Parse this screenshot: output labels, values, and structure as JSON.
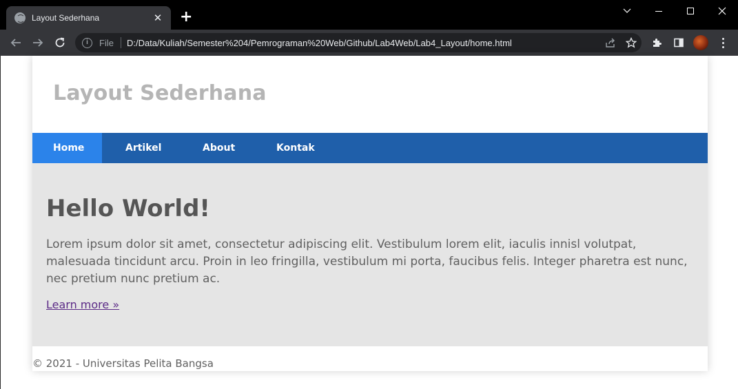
{
  "browser": {
    "tab_title": "Layout Sederhana",
    "new_tab_symbol": "+",
    "close_symbol": "✕",
    "address": {
      "scheme_label": "File",
      "url": "D:/Data/Kuliah/Semester%204/Pemrograman%20Web/Github/Lab4Web/Lab4_Layout/home.html"
    }
  },
  "site": {
    "title": "Layout Sederhana",
    "nav": [
      {
        "label": "Home",
        "active": true
      },
      {
        "label": "Artikel",
        "active": false
      },
      {
        "label": "About",
        "active": false
      },
      {
        "label": "Kontak",
        "active": false
      }
    ],
    "hero": {
      "heading": "Hello World!",
      "text": "Lorem ipsum dolor sit amet, consectetur adipiscing elit. Vestibulum lorem elit, iaculis innisl volutpat, malesuada tincidunt arcu. Proin in leo fringilla, vestibulum mi porta, faucibus felis. Integer pharetra est nunc, nec pretium nunc pretium ac.",
      "link_label": "Learn more »"
    },
    "footer": "© 2021 - Universitas Pelita Bangsa"
  },
  "colors": {
    "nav_bg": "#1f5faa",
    "nav_active": "#2b83ea",
    "hero_bg": "#e5e5e5",
    "title_color": "#b5b5b5",
    "link_color": "#5b2a86"
  }
}
